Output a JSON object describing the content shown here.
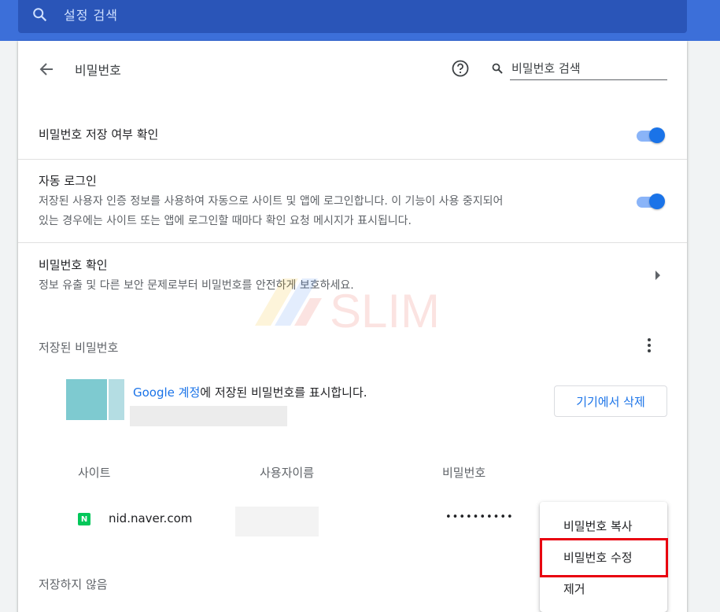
{
  "header": {
    "search_placeholder": "설정 검색"
  },
  "page": {
    "title": "비밀번호",
    "search_placeholder": "비밀번호 검색"
  },
  "settings": {
    "offer_to_save": {
      "label": "비밀번호 저장 여부 확인",
      "enabled": true
    },
    "auto_signin": {
      "label": "자동 로그인",
      "description_line1": "저장된 사용자 인증 정보를 사용하여 자동으로 사이트 및 앱에 로그인합니다. 이 기능이 사용 중지되어",
      "description_line2": "있는 경우에는 사이트 또는 앱에 로그인할 때마다 확인 요청 메시지가 표시됩니다.",
      "enabled": true
    },
    "check_passwords": {
      "label": "비밀번호 확인",
      "description": "정보 유출 및 다른 보안 문제로부터 비밀번호를 안전하게 보호하세요."
    }
  },
  "saved_passwords": {
    "heading": "저장된 비밀번호",
    "account_link": "Google 계정",
    "account_text": "에 저장된 비밀번호를 표시합니다.",
    "delete_button": "기기에서 삭제",
    "columns": [
      "사이트",
      "사용자이름",
      "비밀번호"
    ],
    "rows": [
      {
        "site": "nid.naver.com",
        "favicon": "N",
        "password": "••••••••••"
      }
    ]
  },
  "never_saved": {
    "heading": "저장하지 않음"
  },
  "context_menu": {
    "items": [
      "비밀번호 복사",
      "비밀번호 수정",
      "제거"
    ],
    "highlighted_index": 1
  },
  "watermark": {
    "text": "SLIM"
  },
  "colors": {
    "accent": "#1a73e8",
    "header": "#3c6fd9",
    "highlight": "#e8000f",
    "naver": "#03c75a"
  }
}
